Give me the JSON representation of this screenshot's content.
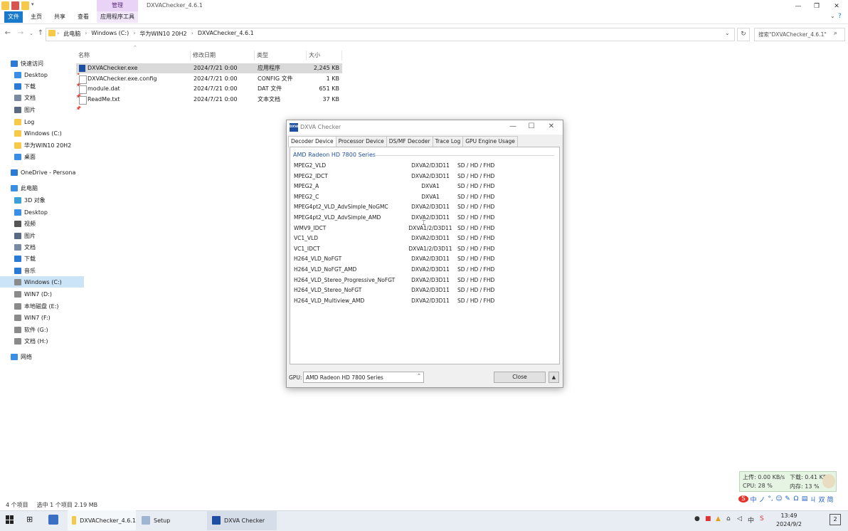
{
  "ribbon": {
    "manage_tab": "管理",
    "window_title": "DXVAChecker_4.6.1",
    "tabs": [
      "文件",
      "主页",
      "共享",
      "查看",
      "应用程序工具"
    ]
  },
  "address": {
    "crumbs": [
      "此电脑",
      "Windows (C:)",
      "华为WIN10 20H2",
      "DXVAChecker_4.6.1"
    ],
    "search_placeholder": "搜索\"DXVAChecker_4.6.1\""
  },
  "sidebar": {
    "items": [
      {
        "label": "快速访问",
        "icon": "star-icon",
        "indent": 0
      },
      {
        "label": "Desktop",
        "icon": "desktop-folder-icon",
        "indent": 1,
        "pinned": true
      },
      {
        "label": "下载",
        "icon": "download-folder-icon",
        "indent": 1,
        "pinned": true
      },
      {
        "label": "文档",
        "icon": "documents-folder-icon",
        "indent": 1,
        "pinned": true
      },
      {
        "label": "图片",
        "icon": "pictures-folder-icon",
        "indent": 1,
        "pinned": true
      },
      {
        "label": "Log",
        "icon": "folder-icon",
        "indent": 1
      },
      {
        "label": "Windows (C:)",
        "icon": "folder-icon",
        "indent": 1
      },
      {
        "label": "华为WIN10 20H2",
        "icon": "folder-icon",
        "indent": 1
      },
      {
        "label": "桌面",
        "icon": "desktop-folder-icon",
        "indent": 1
      },
      {
        "label": "OneDrive - Persona",
        "icon": "cloud-icon",
        "indent": 0
      },
      {
        "label": "此电脑",
        "icon": "computer-icon",
        "indent": 0
      },
      {
        "label": "3D 对象",
        "icon": "3d-objects-icon",
        "indent": 1
      },
      {
        "label": "Desktop",
        "icon": "desktop-folder-icon",
        "indent": 1
      },
      {
        "label": "视频",
        "icon": "video-folder-icon",
        "indent": 1
      },
      {
        "label": "图片",
        "icon": "pictures-folder-icon",
        "indent": 1
      },
      {
        "label": "文档",
        "icon": "documents-folder-icon",
        "indent": 1
      },
      {
        "label": "下载",
        "icon": "download-folder-icon",
        "indent": 1
      },
      {
        "label": "音乐",
        "icon": "music-folder-icon",
        "indent": 1
      },
      {
        "label": "Windows (C:)",
        "icon": "drive-icon",
        "indent": 1,
        "selected": true
      },
      {
        "label": "WIN7 (D:)",
        "icon": "drive-icon",
        "indent": 1
      },
      {
        "label": "本地磁盘 (E:)",
        "icon": "drive-icon",
        "indent": 1
      },
      {
        "label": "WIN7 (F:)",
        "icon": "drive-icon",
        "indent": 1
      },
      {
        "label": "软件 (G:)",
        "icon": "drive-icon",
        "indent": 1
      },
      {
        "label": "文档 (H:)",
        "icon": "drive-icon",
        "indent": 1
      },
      {
        "label": "网络",
        "icon": "network-icon",
        "indent": 0
      }
    ]
  },
  "file_list": {
    "columns": [
      "名称",
      "修改日期",
      "类型",
      "大小"
    ],
    "rows": [
      {
        "name": "DXVAChecker.exe",
        "date": "2024/7/21 0:00",
        "type": "应用程序",
        "size": "2,245 KB",
        "selected": true,
        "icon": "exe-icon"
      },
      {
        "name": "DXVAChecker.exe.config",
        "date": "2024/7/21 0:00",
        "type": "CONFIG 文件",
        "size": "1 KB",
        "icon": "file-icon"
      },
      {
        "name": "module.dat",
        "date": "2024/7/21 0:00",
        "type": "DAT 文件",
        "size": "651 KB",
        "icon": "file-icon"
      },
      {
        "name": "ReadMe.txt",
        "date": "2024/7/21 0:00",
        "type": "文本文档",
        "size": "37 KB",
        "icon": "text-file-icon"
      }
    ]
  },
  "status_bar": {
    "count": "4 个项目",
    "selection": "选中 1 个项目  2.19 MB"
  },
  "dxva": {
    "logo": "DXVA",
    "title": "DXVA Checker",
    "tabs": [
      "Decoder Device",
      "Processor Device",
      "DS/MF Decoder",
      "Trace Log",
      "GPU Engine Usage"
    ],
    "active_tab": 0,
    "group": "AMD Radeon HD 7800 Series",
    "decoders": [
      {
        "name": "MPEG2_VLD",
        "api": "DXVA2/D3D11",
        "res": "SD / HD / FHD"
      },
      {
        "name": "MPEG2_IDCT",
        "api": "DXVA2/D3D11",
        "res": "SD / HD / FHD"
      },
      {
        "name": "MPEG2_A",
        "api": "DXVA1",
        "res": "SD / HD / FHD"
      },
      {
        "name": "MPEG2_C",
        "api": "DXVA1",
        "res": "SD / HD / FHD"
      },
      {
        "name": "MPEG4pt2_VLD_AdvSimple_NoGMC",
        "api": "DXVA2/D3D11",
        "res": "SD / HD / FHD"
      },
      {
        "name": "MPEG4pt2_VLD_AdvSimple_AMD",
        "api": "DXVA2/D3D11",
        "res": "SD / HD / FHD"
      },
      {
        "name": "WMV9_IDCT",
        "api": "DXVA1/2/D3D11",
        "res": "SD / HD / FHD"
      },
      {
        "name": "VC1_VLD",
        "api": "DXVA2/D3D11",
        "res": "SD / HD / FHD"
      },
      {
        "name": "VC1_IDCT",
        "api": "DXVA1/2/D3D11",
        "res": "SD / HD / FHD"
      },
      {
        "name": "H264_VLD_NoFGT",
        "api": "DXVA2/D3D11",
        "res": "SD / HD / FHD"
      },
      {
        "name": "H264_VLD_NoFGT_AMD",
        "api": "DXVA2/D3D11",
        "res": "SD / HD / FHD"
      },
      {
        "name": "H264_VLD_Stereo_Progressive_NoFGT",
        "api": "DXVA2/D3D11",
        "res": "SD / HD / FHD"
      },
      {
        "name": "H264_VLD_Stereo_NoFGT",
        "api": "DXVA2/D3D11",
        "res": "SD / HD / FHD"
      },
      {
        "name": "H264_VLD_Multiview_AMD",
        "api": "DXVA2/D3D11",
        "res": "SD / HD / FHD"
      }
    ],
    "gpu_label": "GPU:",
    "gpu_value": "AMD Radeon HD 7800 Series",
    "close_label": "Close"
  },
  "net_widget": {
    "up": "上传: 0.00 KB/s",
    "down": "下载: 0.41 KB/s",
    "cpu": "CPU: 28 %",
    "mem": "内存: 13 %"
  },
  "ime": {
    "items": [
      "S",
      "中",
      "ノ",
      "°,",
      "☺",
      "✎",
      "Ω",
      "▤",
      "ㄐ",
      "双",
      "简"
    ]
  },
  "taskbar": {
    "apps": [
      {
        "label": "DXVAChecker_4.6.1",
        "icon": "folder-icon"
      },
      {
        "label": "Setup",
        "icon": "setup-icon"
      },
      {
        "label": "DXVA Checker",
        "icon": "dxva-icon"
      }
    ],
    "time": "13:49",
    "date": "2024/9/2"
  },
  "colors": {
    "accent": "#1979ca",
    "selection": "#cce4f7",
    "dxva_blue": "#1e4fa3"
  }
}
